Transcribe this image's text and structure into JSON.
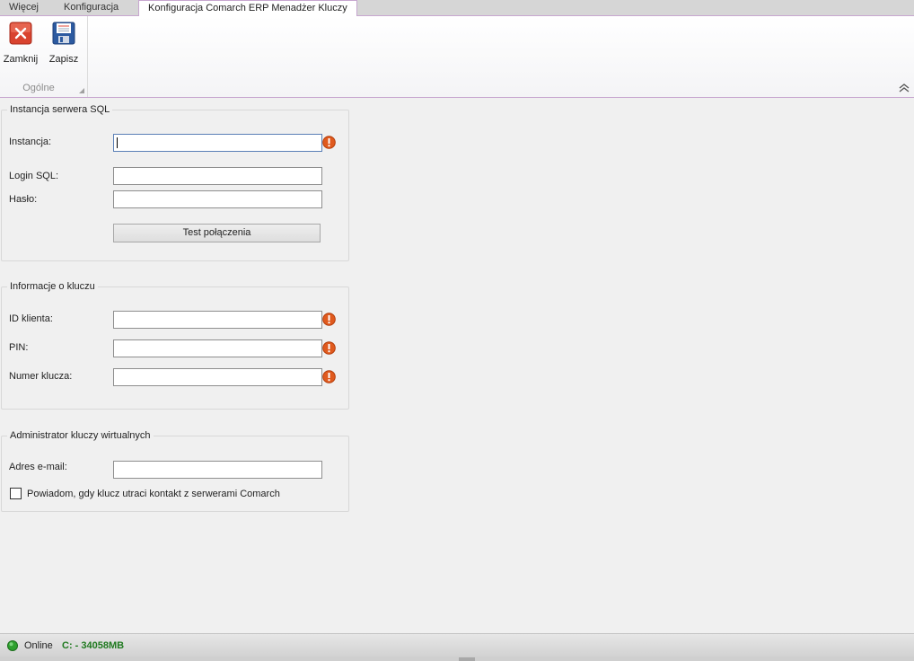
{
  "tabs": [
    {
      "label": "Więcej",
      "active": false
    },
    {
      "label": "Konfiguracja",
      "active": false
    },
    {
      "label": "Konfiguracja Comarch ERP Menadżer Kluczy",
      "active": true
    }
  ],
  "ribbon": {
    "buttons": {
      "close": {
        "label": "Zamknij",
        "icon": "close-red-x-icon"
      },
      "save": {
        "label": "Zapisz",
        "icon": "floppy-disk-icon"
      }
    },
    "group_label": "Ogólne"
  },
  "sql_group": {
    "title": "Instancja serwera SQL",
    "fields": {
      "instance": {
        "label": "Instancja:",
        "value": ""
      },
      "login": {
        "label": "Login SQL:",
        "value": ""
      },
      "password": {
        "label": "Hasło:",
        "value": ""
      }
    },
    "test_button": "Test połączenia"
  },
  "key_group": {
    "title": "Informacje o kluczu",
    "fields": {
      "client_id": {
        "label": "ID klienta:",
        "value": ""
      },
      "pin": {
        "label": "PIN:",
        "value": ""
      },
      "key_number": {
        "label": "Numer klucza:",
        "value": ""
      }
    }
  },
  "admin_group": {
    "title": "Administrator kluczy wirtualnych",
    "email": {
      "label": "Adres e-mail:",
      "value": ""
    },
    "notify_checkbox": {
      "label": "Powiadom, gdy klucz utraci kontakt z serwerami Comarch",
      "checked": false
    }
  },
  "status": {
    "online": "Online",
    "disk": "C: - 34058MB"
  },
  "colors": {
    "accent_border": "#c7a6cf",
    "error_icon": "#e05a1e",
    "online_green": "#2ea02e",
    "disk_text": "#1f7a1f"
  }
}
